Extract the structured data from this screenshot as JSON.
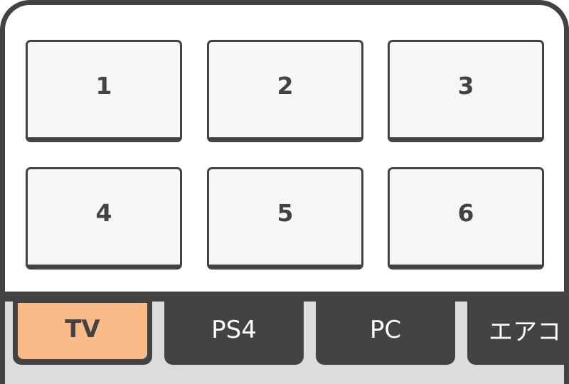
{
  "keypad": {
    "keys": [
      {
        "label": "1"
      },
      {
        "label": "2"
      },
      {
        "label": "3"
      },
      {
        "label": "4"
      },
      {
        "label": "5"
      },
      {
        "label": "6"
      }
    ]
  },
  "tabs": {
    "items": [
      {
        "label": "TV",
        "active": true
      },
      {
        "label": "PS4",
        "active": false
      },
      {
        "label": "PC",
        "active": false
      },
      {
        "label": "エアコ",
        "active": false
      }
    ]
  },
  "colors": {
    "frame": "#434343",
    "key_fill": "#f6f6f6",
    "active_tab": "#fbbb88",
    "tab_bar_bg": "#dcdcdc"
  }
}
